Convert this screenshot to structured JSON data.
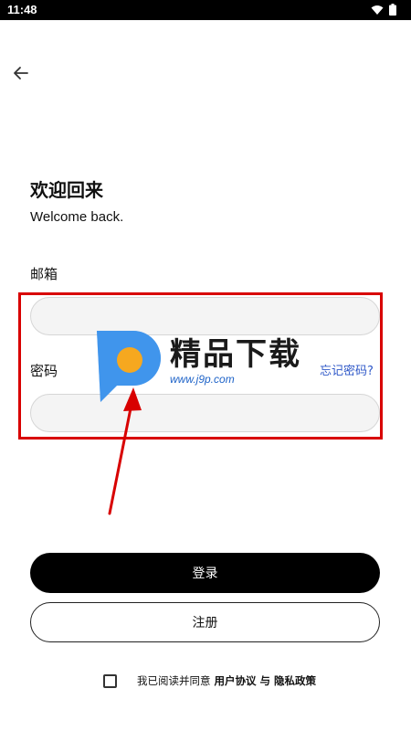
{
  "status_bar": {
    "time": "11:48",
    "icons": [
      "wifi-icon",
      "battery-icon"
    ]
  },
  "header": {
    "back_icon": "arrow-left-icon"
  },
  "login": {
    "title": "欢迎回来",
    "subtitle": "Welcome back.",
    "email_label": "邮箱",
    "email_value": "",
    "password_label": "密码",
    "password_value": "",
    "forgot_password": "忘记密码?",
    "login_button": "登录",
    "register_button": "注册"
  },
  "agreement": {
    "checked": false,
    "prefix": "我已阅读并同意",
    "user_agreement": "用户协议",
    "conjunction": "与",
    "privacy_policy": "隐私政策"
  },
  "watermark": {
    "title": "精品下载",
    "url": "www.j9p.com"
  },
  "colors": {
    "accent_link": "#2f58c8",
    "annotation_red": "#d80000",
    "primary_button": "#000000"
  }
}
